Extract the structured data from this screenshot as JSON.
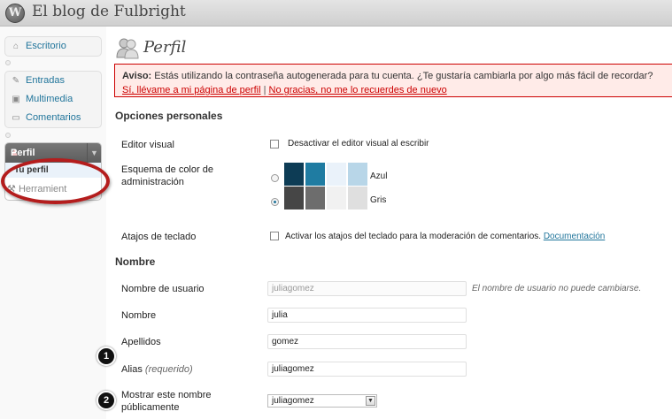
{
  "header": {
    "logo_letter": "W",
    "site_title": "El blog de Fulbright"
  },
  "sidebar": {
    "items": [
      {
        "label": "Escritorio",
        "icon": "home-icon"
      },
      {
        "label": "Entradas",
        "icon": "pin-icon"
      },
      {
        "label": "Multimedia",
        "icon": "media-icon"
      },
      {
        "label": "Comentarios",
        "icon": "comment-icon"
      },
      {
        "label": "Perfil",
        "icon": "user-icon"
      },
      {
        "label": "Tu perfil"
      },
      {
        "label": "Herramient",
        "icon": "tools-icon"
      }
    ]
  },
  "page": {
    "title": "Perfil"
  },
  "notice": {
    "bold": "Aviso:",
    "text": " Estás utilizando la contraseña autogenerada para tu cuenta. ¿Te gustaría cambiarla por algo más fácil de recordar?",
    "link_yes": "Sí, llévame a mi página de perfil",
    "separator": " | ",
    "link_no": "No gracias, no me lo recuerdes de nuevo"
  },
  "personal": {
    "section_title": "Opciones personales",
    "visual_editor": {
      "label": "Editor visual",
      "option": "Desactivar el editor visual al escribir",
      "checked": false
    },
    "color_scheme": {
      "label": "Esquema de color de administración",
      "schemes": [
        {
          "name": "Azul",
          "selected": false,
          "colors": [
            "#0d3c55",
            "#1f7ca2",
            "#eaf2fa",
            "#b8d6e8"
          ]
        },
        {
          "name": "Gris",
          "selected": true,
          "colors": [
            "#464646",
            "#6d6d6d",
            "#f1f1f1",
            "#dfdfdf"
          ]
        }
      ]
    },
    "keyboard": {
      "label": "Atajos de teclado",
      "option": "Activar los atajos del teclado para la moderación de comentarios.",
      "link": "Documentación",
      "checked": false
    }
  },
  "name_section": {
    "section_title": "Nombre",
    "username": {
      "label": "Nombre de usuario",
      "value": "juliagomez",
      "hint": "El nombre de usuario no puede cambiarse."
    },
    "first_name": {
      "label": "Nombre",
      "value": "julia"
    },
    "last_name": {
      "label": "Apellidos",
      "value": "gomez"
    },
    "nickname": {
      "label": "Alias",
      "required": "(requerido)",
      "value": "juliagomez"
    },
    "display_name": {
      "label": "Mostrar este nombre públicamente",
      "value": "juliagomez"
    }
  },
  "steps": [
    "1",
    "2"
  ],
  "colors": {
    "link": "#21759b",
    "notice_border": "#cc0000",
    "highlight_oval": "#b41d1d"
  }
}
